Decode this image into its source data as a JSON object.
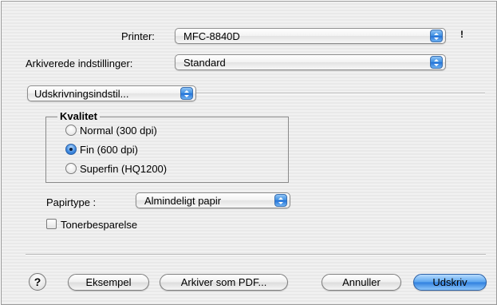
{
  "printer": {
    "label": "Printer:",
    "value": "MFC-8840D",
    "info_glyph": "!"
  },
  "presets": {
    "label": "Arkiverede indstillinger:",
    "value": "Standard"
  },
  "panel_popup": {
    "value": "Udskrivningsindstil..."
  },
  "quality": {
    "title": "Kvalitet",
    "options": [
      {
        "label": "Normal (300 dpi)",
        "selected": false
      },
      {
        "label": "Fin (600 dpi)",
        "selected": true
      },
      {
        "label": "Superfin (HQ1200)",
        "selected": false
      }
    ]
  },
  "paper_type": {
    "label": "Papirtype :",
    "value": "Almindeligt papir"
  },
  "toner_save": {
    "label": "Tonerbesparelse",
    "checked": false
  },
  "buttons": {
    "help": "?",
    "preview": "Eksempel",
    "save_pdf": "Arkiver som PDF...",
    "cancel": "Annuller",
    "print": "Udskriv"
  },
  "colors": {
    "accent": "#3a86de"
  }
}
